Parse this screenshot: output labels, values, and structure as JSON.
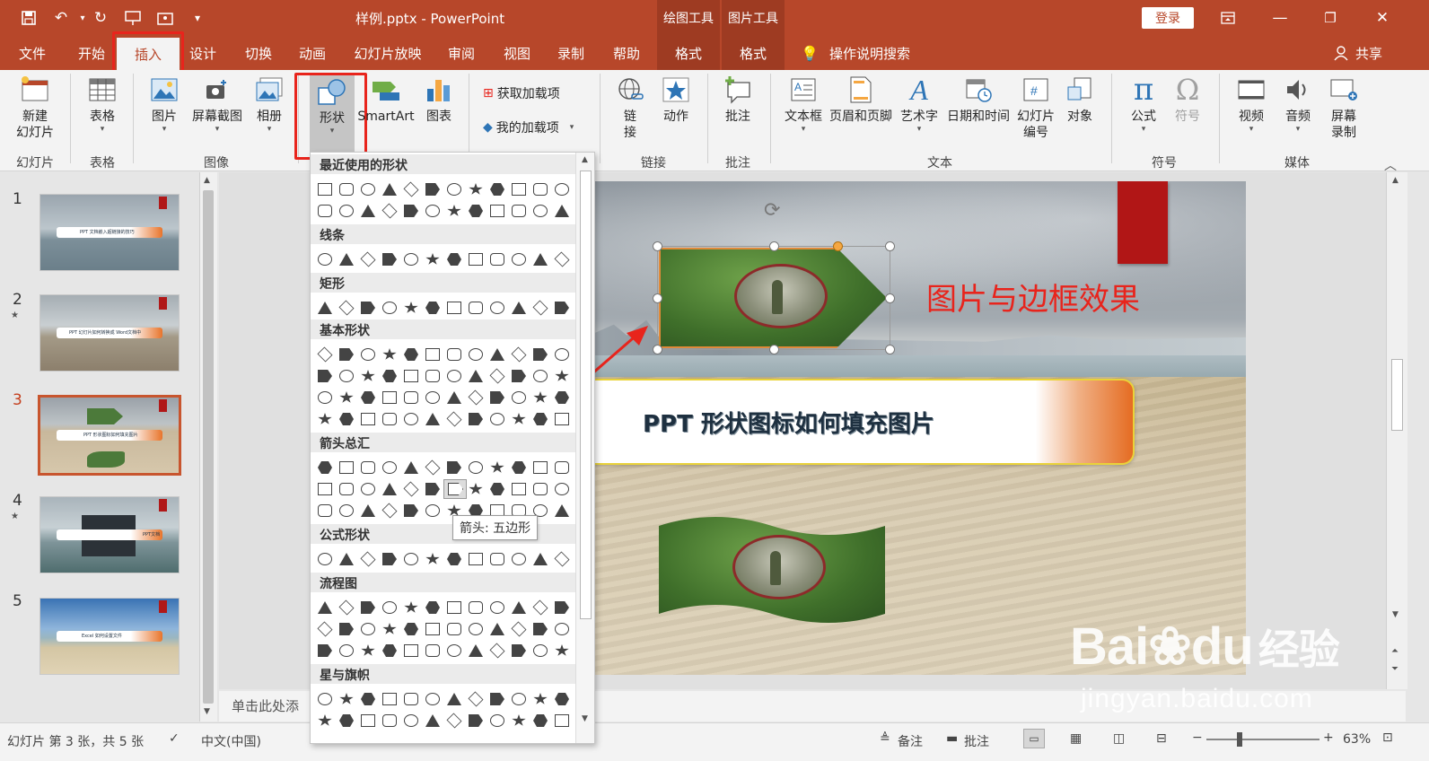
{
  "window": {
    "title": "样例.pptx  -  PowerPoint",
    "context_tabs": [
      "绘图工具",
      "图片工具"
    ],
    "login": "登录",
    "share": "共享",
    "qat_icons": [
      "save-icon",
      "undo-icon",
      "redo-icon",
      "presenter-icon",
      "touch-icon",
      "customize-icon"
    ]
  },
  "tabs": [
    "文件",
    "开始",
    "插入",
    "设计",
    "切换",
    "动画",
    "幻灯片放映",
    "审阅",
    "视图",
    "录制",
    "帮助",
    "格式",
    "格式"
  ],
  "tell_me": "操作说明搜索",
  "ribbon": {
    "new_slide": "新建\n幻灯片",
    "table": "表格",
    "picture": "图片",
    "screenshot": "屏幕截图",
    "album": "相册",
    "shapes": "形状",
    "smartart": "SmartArt",
    "chart": "图表",
    "get_addins": "获取加载项",
    "my_addins": "我的加载项",
    "link": "链\n接",
    "action": "动作",
    "comment": "批注",
    "textbox": "文本框",
    "header_footer": "页眉和页脚",
    "wordart": "艺术字",
    "datetime": "日期和时间",
    "slide_number": "幻灯片\n编号",
    "object": "对象",
    "equation": "公式",
    "symbol": "符号",
    "video": "视频",
    "audio": "音频",
    "screen_record": "屏幕\n录制",
    "groups": [
      "幻灯片",
      "表格",
      "图像",
      "链接",
      "批注",
      "文本",
      "符号",
      "媒体"
    ]
  },
  "shapes_menu": {
    "sections": [
      "最近使用的形状",
      "线条",
      "矩形",
      "基本形状",
      "箭头总汇",
      "公式形状",
      "流程图",
      "星与旗帜"
    ],
    "tooltip": "箭头: 五边形"
  },
  "slides": [
    {
      "num": "1",
      "label": "PPT 文档嵌入超链接的技巧"
    },
    {
      "num": "2",
      "label": "PPT 幻灯片如何转换成 Word文档中"
    },
    {
      "num": "3",
      "label": "PPT 形状图标如何填充图片"
    },
    {
      "num": "4",
      "label": "PPT文档"
    },
    {
      "num": "5",
      "label": "Excel 如何设置文件"
    }
  ],
  "slide": {
    "heading": "图片与边框效果",
    "banner": "PPT 形状图标如何填充图片"
  },
  "notes_placeholder": "单击此处添",
  "status": {
    "slide_info": "幻灯片 第 3 张，共 5 张",
    "language": "中文(中国)",
    "notes": "备注",
    "comments": "批注",
    "zoom": "63%"
  },
  "watermark": {
    "brand": "Bai",
    "brand2": "du",
    "suffix": "经验",
    "url": "jingyan.baidu.com"
  },
  "colors": {
    "accent": "#b7472a",
    "highlight": "#e8241c",
    "heading": "#e8241c"
  }
}
